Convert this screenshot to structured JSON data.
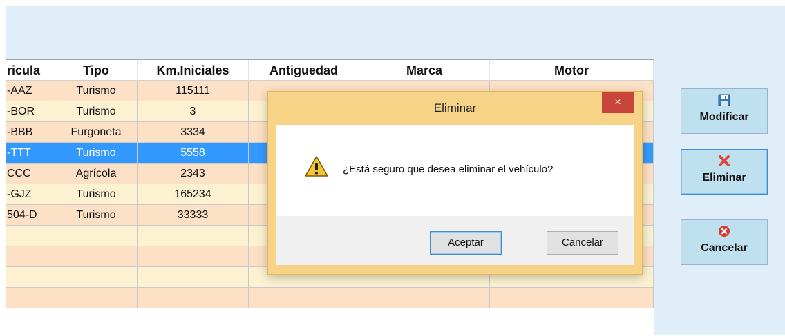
{
  "grid": {
    "columns": [
      "ricula",
      "Tipo",
      "Km.Iniciales",
      "Antiguedad",
      "Marca",
      "Motor"
    ],
    "rows": [
      [
        "-AAZ",
        "Turismo",
        "115111",
        "",
        "",
        ""
      ],
      [
        "-BOR",
        "Turismo",
        "3",
        "",
        "",
        ""
      ],
      [
        "-BBB",
        "Furgoneta",
        "3334",
        "",
        "",
        ""
      ],
      [
        "-TTT",
        "Turismo",
        "5558",
        "",
        "",
        ""
      ],
      [
        "CCC",
        "Agrícola",
        "2343",
        "",
        "",
        ""
      ],
      [
        "-GJZ",
        "Turismo",
        "165234",
        "",
        "",
        ""
      ],
      [
        "504-D",
        "Turismo",
        "33333",
        "",
        "",
        ""
      ],
      [
        "",
        "",
        "",
        "",
        "",
        ""
      ],
      [
        "",
        "",
        "",
        "",
        "",
        ""
      ],
      [
        "",
        "",
        "",
        "",
        "",
        ""
      ],
      [
        "",
        "",
        "",
        "",
        "",
        ""
      ]
    ],
    "selected_row": 3
  },
  "side_buttons": {
    "modify": {
      "label": "Modificar",
      "icon": "save-icon"
    },
    "delete": {
      "label": "Eliminar",
      "icon": "red-x-icon"
    },
    "cancel": {
      "label": "Cancelar",
      "icon": "red-circle-x-icon"
    }
  },
  "dialog": {
    "title": "Eliminar",
    "close_glyph": "×",
    "message": "¿Está seguro que desea eliminar el vehículo?",
    "icon": "warning-icon",
    "accept_label": "Aceptar",
    "cancel_label": "Cancelar"
  },
  "colors": {
    "row_a": "#fde1c6",
    "row_b": "#fcf2d2",
    "row_selected": "#3399ff",
    "dialog_frame": "#f7d387",
    "close_button": "#c7453b",
    "side_button": "#bfe1ef"
  }
}
